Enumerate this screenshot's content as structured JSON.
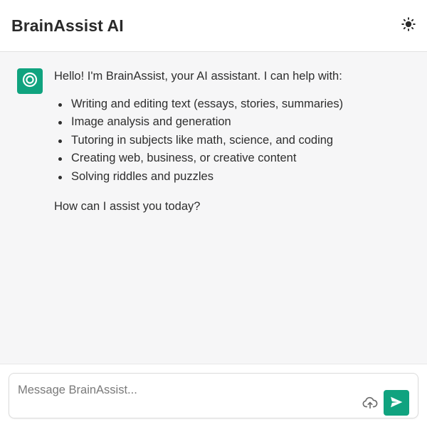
{
  "header": {
    "title": "BrainAssist AI",
    "theme_toggle_icon": "sun-icon"
  },
  "colors": {
    "accent": "#10a37f",
    "chat_background": "#f6f6f7",
    "text": "#2e2e2e"
  },
  "conversation": {
    "messages": [
      {
        "role": "assistant",
        "avatar_icon": "assistant-logo-icon",
        "intro": "Hello! I'm BrainAssist, your AI assistant. I can help with:",
        "items": [
          "Writing and editing text (essays, stories, summaries)",
          "Image analysis and generation",
          "Tutoring in subjects like math, science, and coding",
          "Creating web, business, or creative content",
          "Solving riddles and puzzles"
        ],
        "outro": "How can I assist you today?"
      }
    ]
  },
  "composer": {
    "placeholder": "Message BrainAssist...",
    "value": "",
    "upload_icon": "cloud-upload-icon",
    "send_icon": "send-icon"
  }
}
